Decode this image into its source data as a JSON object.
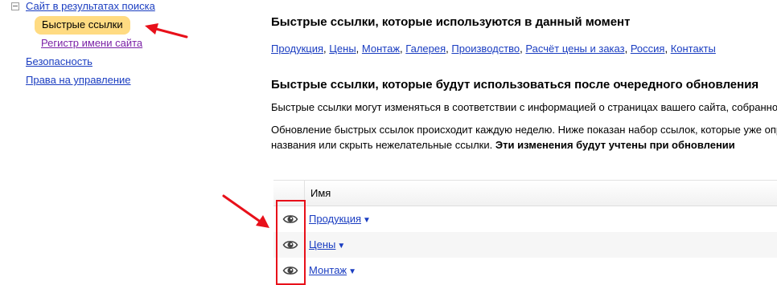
{
  "sidebar": {
    "items": [
      {
        "label": "Сайт в результатах поиска",
        "state": "expanded"
      },
      {
        "label": "Быстрые ссылки",
        "state": "selected"
      },
      {
        "label": "Регистр имени сайта",
        "state": "visited"
      },
      {
        "label": "Безопасность"
      },
      {
        "label": "Права на управление"
      }
    ]
  },
  "main": {
    "current_title": "Быстрые ссылки, которые используются в данный момент",
    "current_links": [
      "Продукция",
      "Цены",
      "Монтаж",
      "Галерея",
      "Производство",
      "Расчёт цены и заказ",
      "Россия",
      "Контакты"
    ],
    "current_links_separator": ",",
    "next_title": "Быстрые ссылки, которые будут использоваться после очередного обновления",
    "paragraph1": "Быстрые ссылки могут изменяться в соответствии с информацией о страницах вашего сайта, собранной",
    "paragraph2_line1": "Обновление быстрых ссылок происходит каждую неделю. Ниже показан набор ссылок, которые уже опр",
    "paragraph2_line2": "названия или скрыть нежелательные ссылки.",
    "paragraph2_bold": "Эти изменения будут учтены при обновлении"
  },
  "table": {
    "column_name": "Имя",
    "rows": [
      {
        "name": "Продукция",
        "icon": "eye-icon",
        "menu_glyph": "▼"
      },
      {
        "name": "Цены",
        "icon": "eye-icon",
        "menu_glyph": "▼"
      },
      {
        "name": "Монтаж",
        "icon": "eye-icon",
        "menu_glyph": "▼"
      }
    ]
  },
  "colors": {
    "link": "#1a3dc1",
    "visited_link": "#7b21a6",
    "selected_highlight": "#ffdb82",
    "annotation_red": "#e8101a"
  }
}
